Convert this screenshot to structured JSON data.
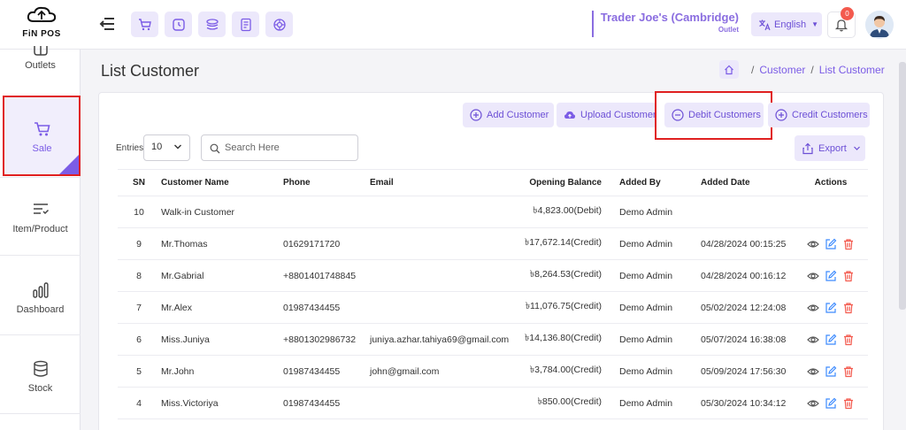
{
  "header": {
    "logo_text": "FiN POS",
    "store_name": "Trader Joe's (Cambridge)",
    "store_type": "Outlet",
    "language": "English",
    "notification_count": "0",
    "quick_icons": [
      "cart-icon",
      "clock-icon",
      "layers-icon",
      "receipt-icon",
      "support-icon"
    ]
  },
  "sidebar": {
    "items": [
      {
        "label": "Outlets",
        "icon": "outlets-icon"
      },
      {
        "label": "Sale",
        "icon": "cart-icon",
        "active": true
      },
      {
        "label": "Item/Product",
        "icon": "item-product-icon"
      },
      {
        "label": "Dashboard",
        "icon": "dashboard-icon"
      },
      {
        "label": "Stock",
        "icon": "database-icon"
      }
    ]
  },
  "page": {
    "title": "List Customer",
    "breadcrumb": [
      "Customer",
      "List Customer"
    ]
  },
  "actions": {
    "add": "Add Customer",
    "upload": "Upload Customer",
    "debit": "Debit Customers",
    "credit": "Credit Customers",
    "export": "Export"
  },
  "controls": {
    "entries_label": "Entries",
    "entries_value": "10",
    "search_placeholder": "Search Here"
  },
  "table": {
    "columns": {
      "sn": "SN",
      "name": "Customer Name",
      "phone": "Phone",
      "email": "Email",
      "balance": "Opening Balance",
      "added_by": "Added By",
      "added_date": "Added Date",
      "actions": "Actions"
    },
    "rows": [
      {
        "sn": "10",
        "name": "Walk-in Customer",
        "phone": "",
        "email": "",
        "balance": "৳4,823.00(Debit)",
        "added_by": "Demo Admin",
        "added_date": "",
        "actions": false
      },
      {
        "sn": "9",
        "name": "Mr.Thomas",
        "phone": "01629171720",
        "email": "",
        "balance": "৳17,672.14(Credit)",
        "added_by": "Demo Admin",
        "added_date": "04/28/2024 00:15:25",
        "actions": true
      },
      {
        "sn": "8",
        "name": "Mr.Gabrial",
        "phone": "+8801401748845",
        "email": "",
        "balance": "৳8,264.53(Credit)",
        "added_by": "Demo Admin",
        "added_date": "04/28/2024 00:16:12",
        "actions": true
      },
      {
        "sn": "7",
        "name": "Mr.Alex",
        "phone": "01987434455",
        "email": "",
        "balance": "৳11,076.75(Credit)",
        "added_by": "Demo Admin",
        "added_date": "05/02/2024 12:24:08",
        "actions": true
      },
      {
        "sn": "6",
        "name": "Miss.Juniya",
        "phone": "+8801302986732",
        "email": "juniya.azhar.tahiya69@gmail.com",
        "balance": "৳14,136.80(Credit)",
        "added_by": "Demo Admin",
        "added_date": "05/07/2024 16:38:08",
        "actions": true
      },
      {
        "sn": "5",
        "name": "Mr.John",
        "phone": "01987434455",
        "email": "john@gmail.com",
        "balance": "৳3,784.00(Credit)",
        "added_by": "Demo Admin",
        "added_date": "05/09/2024 17:56:30",
        "actions": true
      },
      {
        "sn": "4",
        "name": "Miss.Victoriya",
        "phone": "01987434455",
        "email": "",
        "balance": "৳850.00(Credit)",
        "added_by": "Demo Admin",
        "added_date": "05/30/2024 10:34:12",
        "actions": true
      }
    ]
  },
  "colors": {
    "accent": "#7b5ce6",
    "accent_bg": "#ece8fb",
    "highlight": "#e02020",
    "view_icon": "#555555",
    "edit_icon": "#3d8bfd",
    "delete_icon": "#f35a4e"
  }
}
